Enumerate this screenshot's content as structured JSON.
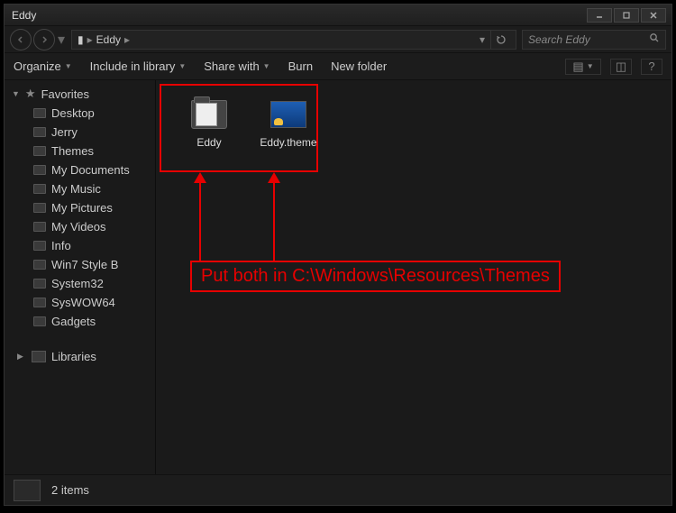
{
  "window": {
    "title": "Eddy"
  },
  "address": {
    "folder_icon": "folder-icon",
    "crumb1": "Eddy"
  },
  "search": {
    "placeholder": "Search Eddy"
  },
  "toolbar": {
    "organize": "Organize",
    "include": "Include in library",
    "share": "Share with",
    "burn": "Burn",
    "newfolder": "New folder"
  },
  "sidebar": {
    "favorites_label": "Favorites",
    "items": [
      {
        "label": "Desktop"
      },
      {
        "label": "Jerry"
      },
      {
        "label": "Themes"
      },
      {
        "label": "My Documents"
      },
      {
        "label": "My Music"
      },
      {
        "label": "My Pictures"
      },
      {
        "label": "My Videos"
      },
      {
        "label": "Info"
      },
      {
        "label": "Win7 Style B"
      },
      {
        "label": "System32"
      },
      {
        "label": "SysWOW64"
      },
      {
        "label": "Gadgets"
      }
    ],
    "libraries_label": "Libraries"
  },
  "items": [
    {
      "label": "Eddy",
      "type": "folder"
    },
    {
      "label": "Eddy.theme",
      "type": "theme"
    }
  ],
  "annotation": {
    "text": "Put both in C:\\Windows\\Resources\\Themes"
  },
  "status": {
    "count_text": "2 items"
  }
}
